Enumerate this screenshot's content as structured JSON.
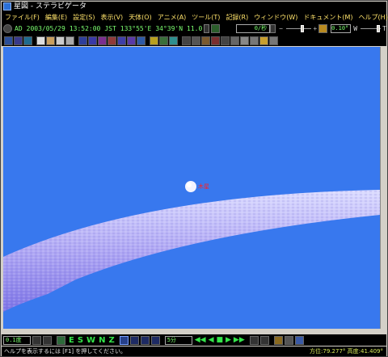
{
  "window": {
    "title": "星図 - ステラビゲータ"
  },
  "menu": [
    "ファイル(F)",
    "編集(E)",
    "設定(S)",
    "表示(V)",
    "天体(O)",
    "アニメ(A)",
    "ツール(T)",
    "記録(R)",
    "ウィンドウ(W)",
    "ドキュメント(M)",
    "ヘルプ(H)"
  ],
  "timebar": {
    "era": "AD",
    "date": "2003/05/29",
    "time": "13:52:00",
    "zone": "JST",
    "longitude": "133°55'E",
    "latitude": "34°39'N",
    "elevation": "11.0",
    "speed": "0/秒",
    "fov": "0.10°",
    "fov_left_label": "W",
    "fov_right_label": "T"
  },
  "sky": {
    "planet_label": "木星"
  },
  "bottom": {
    "zoom": "0.1度",
    "directions": [
      "E",
      "S",
      "W",
      "N",
      "Z"
    ],
    "step": "5分"
  },
  "status": {
    "help": "ヘルプを表示するには [F1] を押してください。",
    "azimuth": "方位:79.277°",
    "altitude": "高度:41.409°"
  },
  "colors": {
    "sky": "#3878ee",
    "lcd_text": "#7cff70",
    "menu_text": "#ffe36b",
    "planet_label": "#ff2020"
  }
}
